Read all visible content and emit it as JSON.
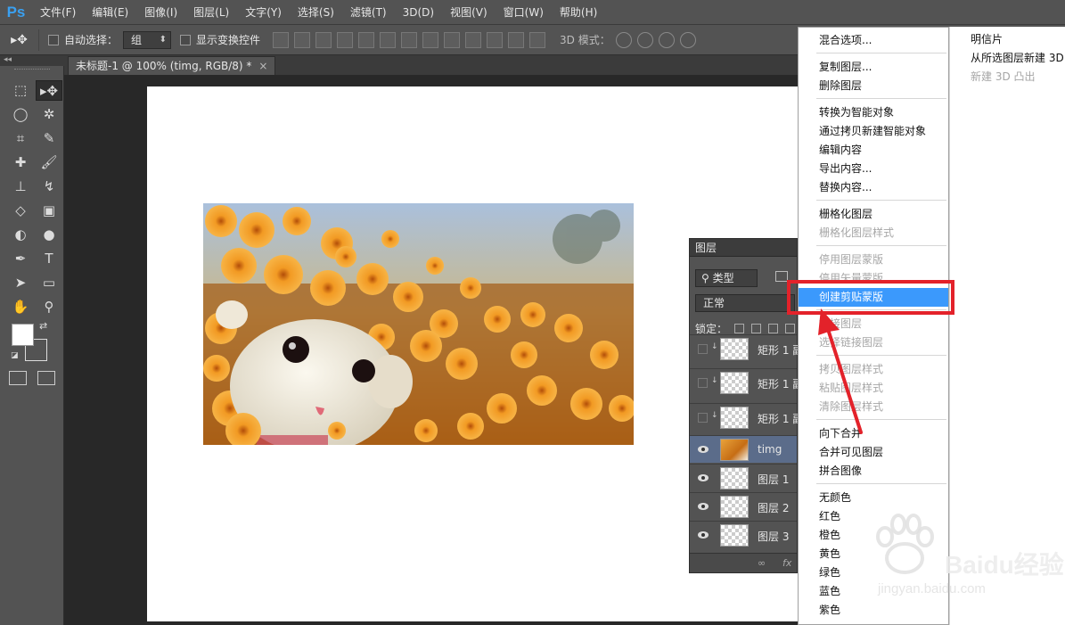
{
  "app": {
    "logo": "Ps",
    "menu": [
      "文件(F)",
      "编辑(E)",
      "图像(I)",
      "图层(L)",
      "文字(Y)",
      "选择(S)",
      "滤镜(T)",
      "3D(D)",
      "视图(V)",
      "窗口(W)",
      "帮助(H)"
    ]
  },
  "options_bar": {
    "auto_select_label": "自动选择：",
    "auto_select_value": "组",
    "show_transform_label": "显示变换控件",
    "mode_3d_label": "3D 模式："
  },
  "document": {
    "tab_title": "未标题-1 @ 100% (timg, RGB/8) *",
    "tab_close": "×",
    "panel_collapse": "◂◂"
  },
  "layers_panel": {
    "title": "图层",
    "filter_label": "类型",
    "blend_mode": "正常",
    "lock_label": "锁定：",
    "layers": [
      {
        "name": "矩形 1 副本",
        "visible": false,
        "thumb": "transparent",
        "clipped": true
      },
      {
        "name": "矩形 1 副本",
        "visible": false,
        "thumb": "transparent",
        "clipped": true
      },
      {
        "name": "矩形 1 副本",
        "visible": false,
        "thumb": "transparent",
        "clipped": true
      },
      {
        "name": "timg",
        "visible": true,
        "thumb": "image",
        "selected": true
      },
      {
        "name": "图层 1",
        "visible": true,
        "thumb": "transparent"
      },
      {
        "name": "图层 2",
        "visible": true,
        "thumb": "transparent"
      },
      {
        "name": "图层 3",
        "visible": true,
        "thumb": "transparent"
      }
    ],
    "footer_link": "∞",
    "footer_fx": "fx"
  },
  "context_menu": {
    "items": [
      {
        "label": "混合选项...",
        "disabled": false
      },
      {
        "label": "复制图层...",
        "disabled": false
      },
      {
        "label": "删除图层",
        "disabled": false
      },
      {
        "label": "转换为智能对象",
        "disabled": false
      },
      {
        "label": "通过拷贝新建智能对象",
        "disabled": false
      },
      {
        "label": "编辑内容",
        "disabled": false
      },
      {
        "label": "导出内容...",
        "disabled": false
      },
      {
        "label": "替换内容...",
        "disabled": false
      },
      {
        "label": "栅格化图层",
        "disabled": false
      },
      {
        "label": "栅格化图层样式",
        "disabled": true
      },
      {
        "label": "停用图层蒙版",
        "disabled": true
      },
      {
        "label": "停用矢量蒙版",
        "disabled": true
      },
      {
        "label": "创建剪贴蒙版",
        "disabled": false,
        "highlighted": true
      },
      {
        "label": "链接图层",
        "disabled": true
      },
      {
        "label": "选择链接图层",
        "disabled": true
      },
      {
        "label": "拷贝图层样式",
        "disabled": true
      },
      {
        "label": "粘贴图层样式",
        "disabled": true
      },
      {
        "label": "清除图层样式",
        "disabled": true
      },
      {
        "label": "向下合并",
        "disabled": false
      },
      {
        "label": "合并可见图层",
        "disabled": false
      },
      {
        "label": "拼合图像",
        "disabled": false
      },
      {
        "label": "无颜色",
        "disabled": false
      },
      {
        "label": "红色",
        "disabled": false
      },
      {
        "label": "橙色",
        "disabled": false
      },
      {
        "label": "黄色",
        "disabled": false
      },
      {
        "label": "绿色",
        "disabled": false
      },
      {
        "label": "蓝色",
        "disabled": false
      },
      {
        "label": "紫色",
        "disabled": false
      }
    ],
    "submenu_items": [
      {
        "label": "明信片",
        "disabled": false
      },
      {
        "label": "从所选图层新建 3D",
        "disabled": false
      },
      {
        "label": "新建 3D 凸出",
        "disabled": true
      }
    ]
  },
  "watermark": {
    "brand": "Baidu经验",
    "url": "jingyan.baidu.com"
  },
  "colors": {
    "highlight": "#3b99fc",
    "annotation_red": "#e3222a",
    "ps_blue": "#3aa0f0"
  }
}
